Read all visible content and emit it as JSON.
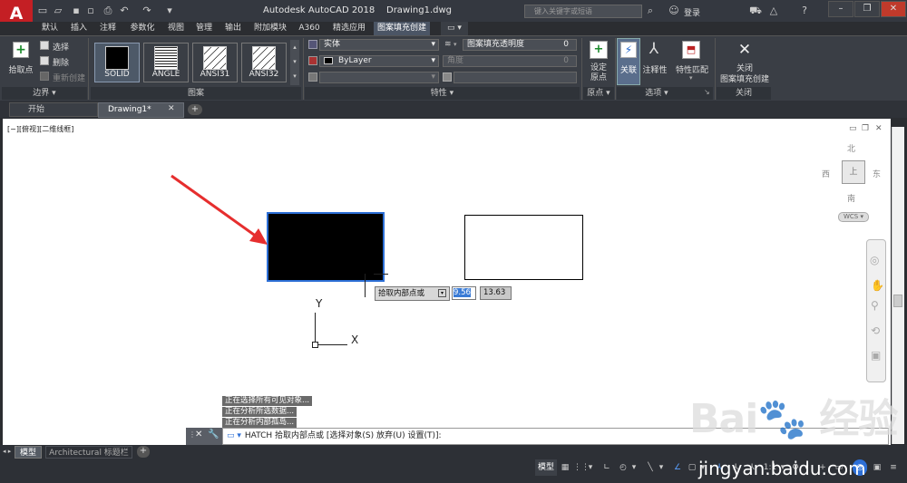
{
  "app": {
    "logo": "A",
    "title": "Autodesk AutoCAD 2018",
    "filename": "Drawing1.dwg"
  },
  "search": {
    "placeholder": "键入关键字或短语"
  },
  "user": {
    "login": "登录"
  },
  "ribbon_tabs": [
    "默认",
    "插入",
    "注释",
    "参数化",
    "视图",
    "管理",
    "输出",
    "附加模块",
    "A360",
    "精选应用",
    "图案填充创建"
  ],
  "active_tab": "图案填充创建",
  "boundary": {
    "pick_label": "拾取点",
    "select_label": "选择",
    "remove_label": "删除",
    "recreate_label": "重新创建",
    "panel_label": "边界"
  },
  "patterns": {
    "items": [
      "SOLID",
      "ANGLE",
      "ANSI31",
      "ANSI32"
    ],
    "panel_label": "图案"
  },
  "properties": {
    "type": "实体",
    "transparency_label": "图案填充透明度",
    "transparency_value": "0",
    "color": "ByLayer",
    "angle_label": "角度",
    "angle_value": "0",
    "panel_label": "特性"
  },
  "origin": {
    "set_label_1": "设定",
    "set_label_2": "原点",
    "panel_label": "原点"
  },
  "options": {
    "assoc_label": "关联",
    "annot_label": "注释性",
    "match_label": "特性匹配",
    "panel_label": "选项"
  },
  "close": {
    "label_1": "关闭",
    "label_2": "图案填充创建",
    "panel_label": "关闭"
  },
  "doc_tabs": {
    "start": "开始",
    "drawing": "Drawing1*"
  },
  "viewport": {
    "label": "[−][俯视][二维线框]"
  },
  "viewcube": {
    "north": "北",
    "south": "南",
    "east": "东",
    "west": "西",
    "top": "上",
    "wcs": "WCS"
  },
  "ucs": {
    "x": "X",
    "y": "Y"
  },
  "tooltip": {
    "prompt": "拾取内部点或",
    "x_value": "9.56",
    "y_value": "13.63"
  },
  "history": [
    "正在选择所有可见对象...",
    "正在分析所选数据...",
    "正在分析内部孤岛..."
  ],
  "command": {
    "text": "HATCH 拾取内部点或 [选择对象(S) 放弃(U) 设置(T)]:"
  },
  "layout_tabs": [
    "模型",
    "Architectural 标题栏"
  ],
  "status": {
    "model": "模型",
    "scale": "1:1"
  },
  "watermark": {
    "site": "jingyan.baidu.com"
  },
  "colors": {
    "accent": "#2d6fd6",
    "autocad_red": "#c41f24",
    "ribbon": "#3a3e45"
  }
}
